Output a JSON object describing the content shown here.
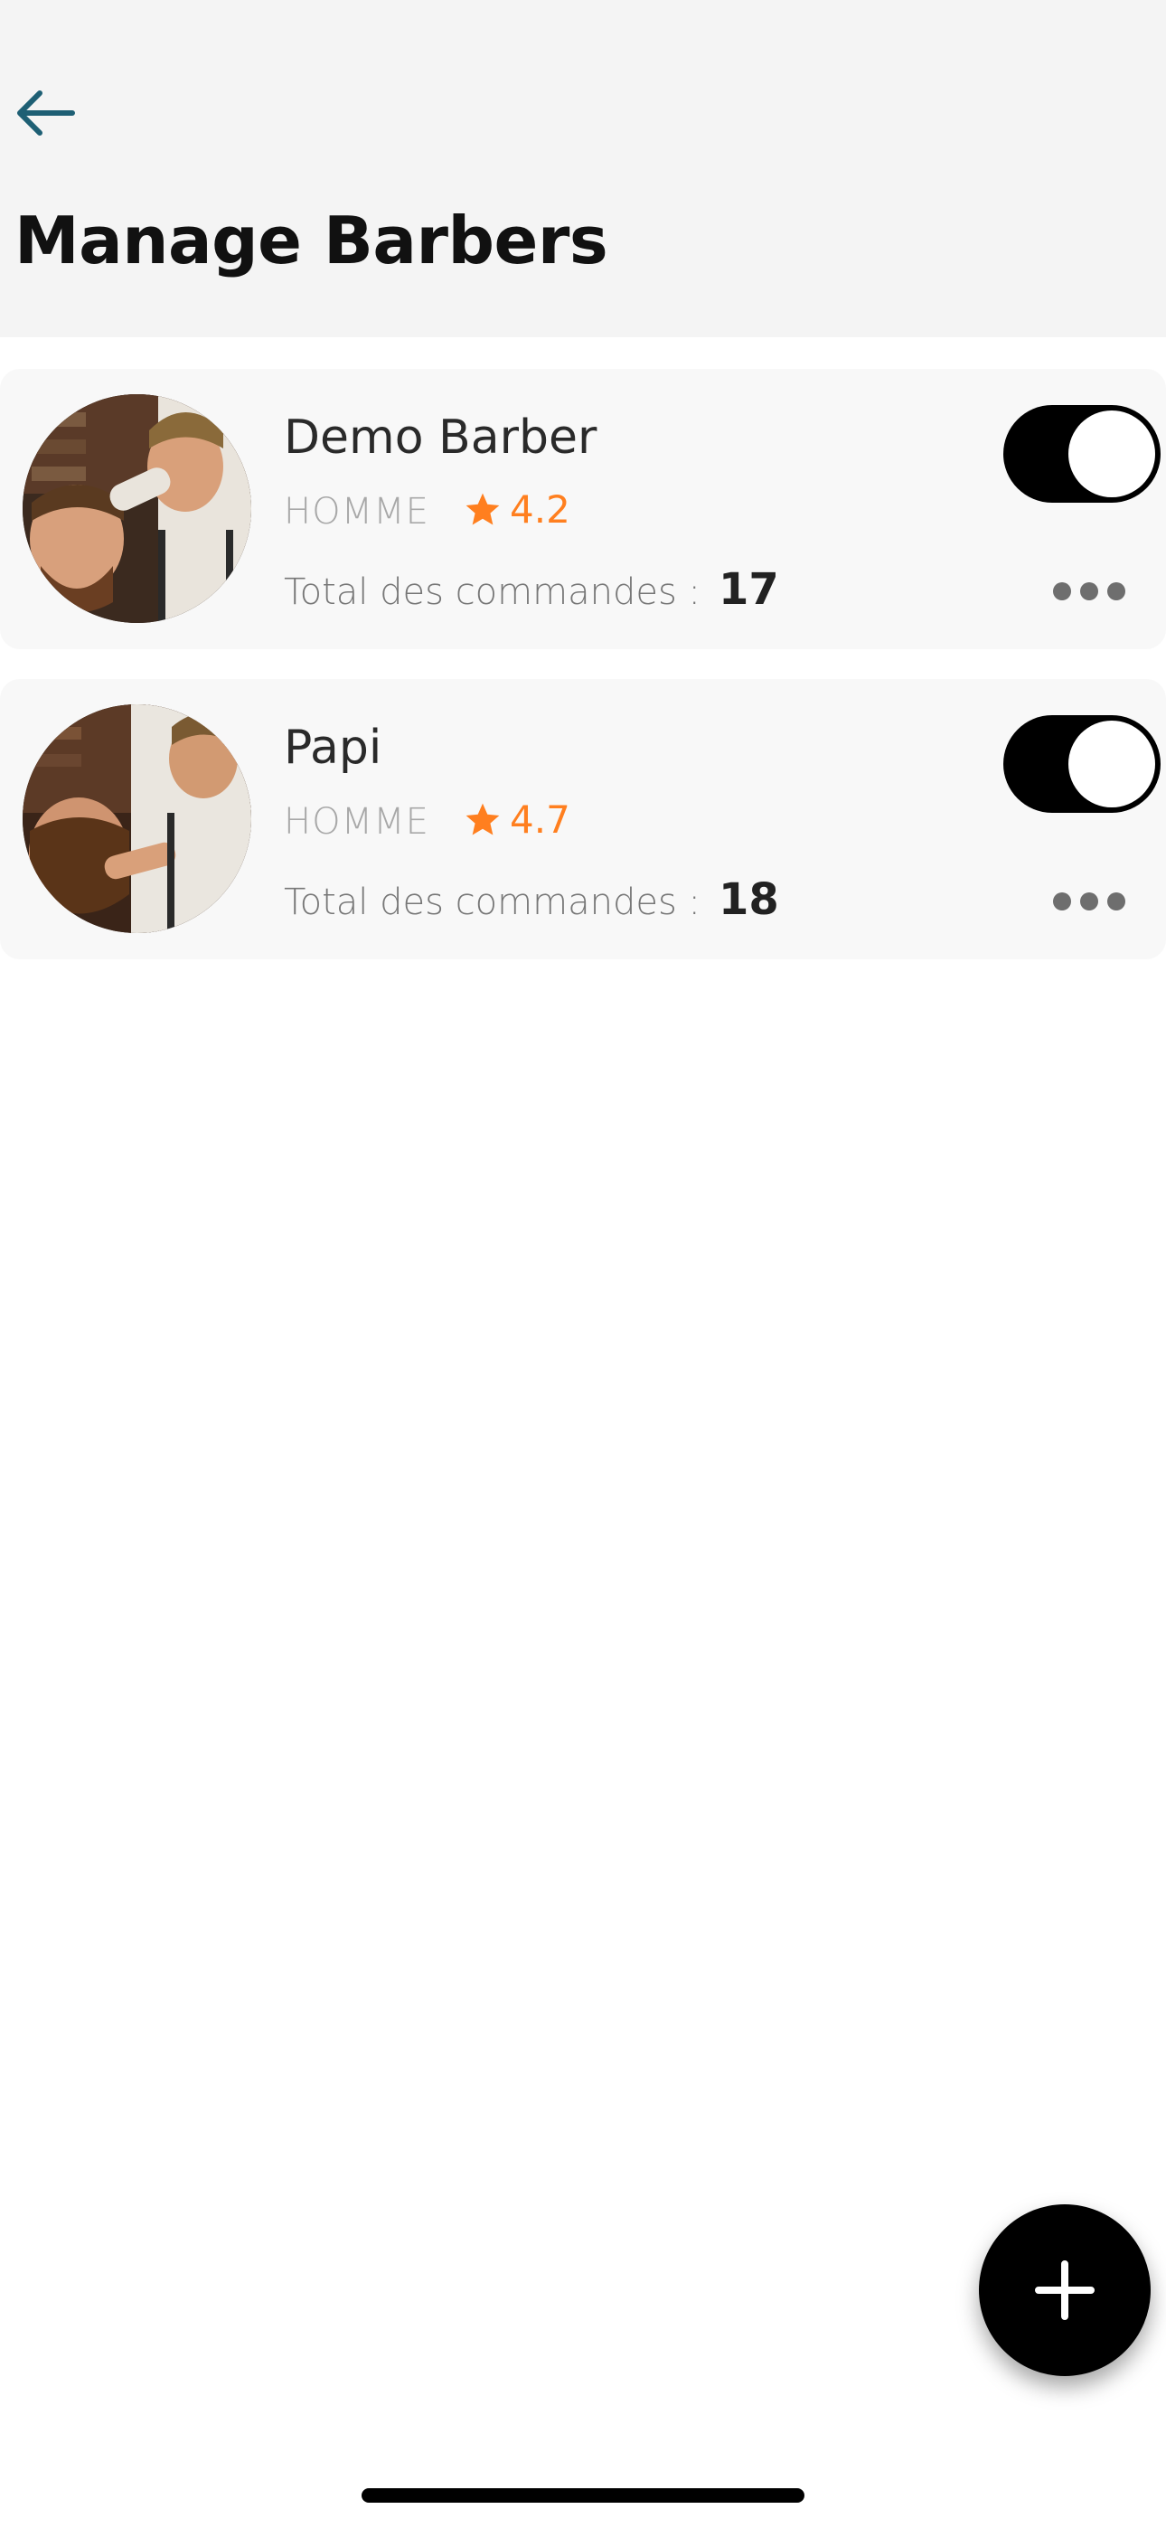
{
  "header": {
    "title": "Manage Barbers",
    "back_icon": "arrow-left-icon",
    "back_icon_color": "#1e5f74",
    "background": "#f4f4f4"
  },
  "barbers": [
    {
      "name": "Demo Barber",
      "category": "HOMME",
      "rating": "4.2",
      "orders_label": "Total des commandes :",
      "orders_count": "17",
      "active": true
    },
    {
      "name": "Papi",
      "category": "HOMME",
      "rating": "4.7",
      "orders_label": "Total des commandes :",
      "orders_count": "18",
      "active": true
    }
  ],
  "icons": {
    "star": "star-icon",
    "more": "more-horizontal-icon",
    "add": "plus-icon"
  },
  "colors": {
    "accent": "#ff7f1f",
    "toggle_on": "#000000",
    "fab": "#000000",
    "card_background": "#f8f8f8"
  }
}
